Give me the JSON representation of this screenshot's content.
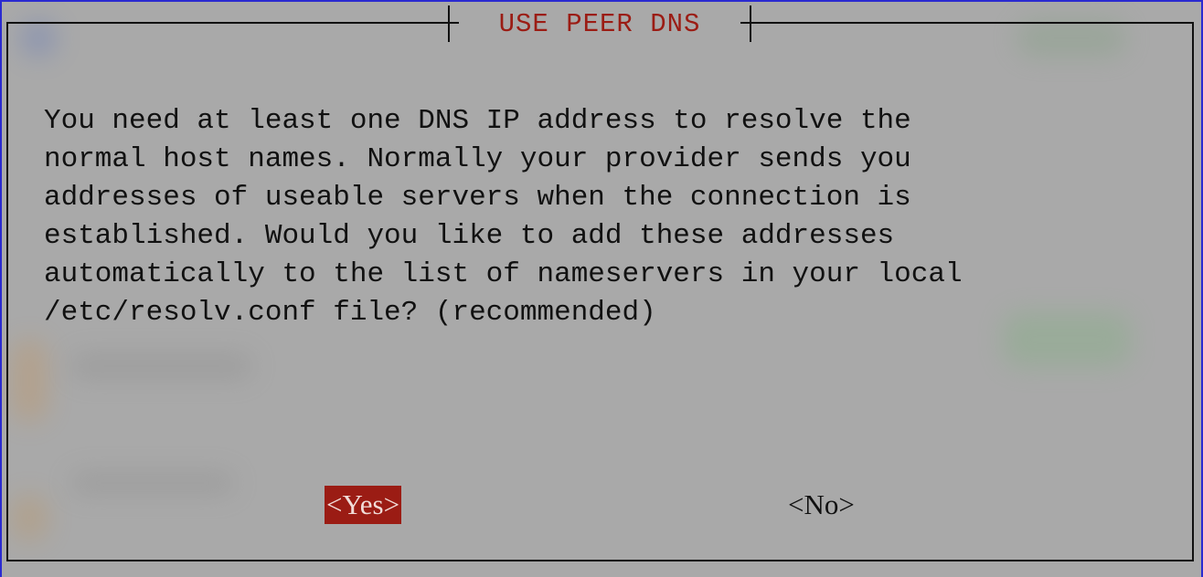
{
  "dialog": {
    "title": "USE PEER DNS",
    "message_lines": [
      "You need at least one DNS IP address to resolve the",
      "normal host names. Normally your provider sends you",
      "addresses of useable servers when the connection is",
      "established. Would you like to add these addresses",
      "automatically to the list of nameservers in your local",
      "/etc/resolv.conf file? (recommended)"
    ],
    "yes_label": "<Yes>",
    "no_label": "<No>"
  },
  "colors": {
    "title": "#9b1c14",
    "selected_button_bg": "#9b1c14",
    "dialog_bg": "#a9a9a9",
    "screen_border": "#2a2ad0"
  }
}
